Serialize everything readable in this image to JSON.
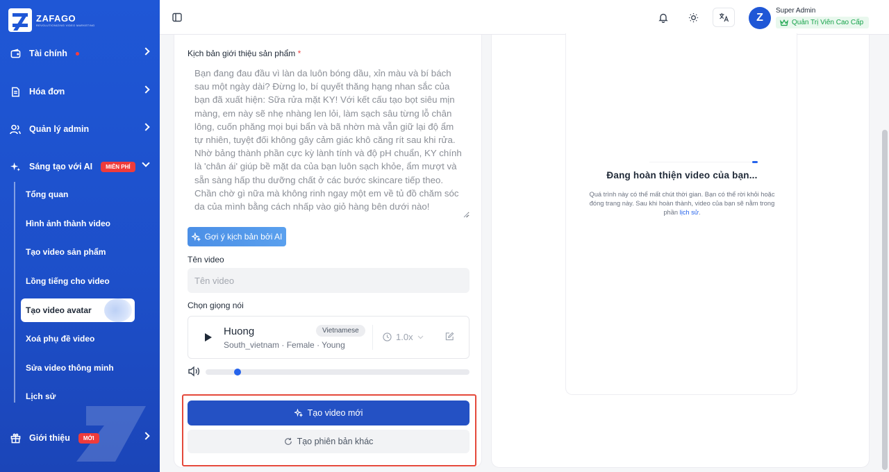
{
  "brand": {
    "name": "ZAFAGO",
    "tagline": "REVOLUTIONIZING VIDEO MARKETING"
  },
  "sidebar": {
    "items": [
      {
        "label": "Tài chính",
        "icon": "wallet-icon"
      },
      {
        "label": "Hóa đơn",
        "icon": "invoice-icon"
      },
      {
        "label": "Quản lý admin",
        "icon": "users-icon"
      },
      {
        "label": "Sáng tạo với AI",
        "icon": "sparkle-icon",
        "badge": "MIỄN PHÍ"
      },
      {
        "label": "Giới thiệu",
        "icon": "gift-icon",
        "badge": "MỚI"
      }
    ],
    "sub_items": [
      "Tổng quan",
      "Hình ảnh thành video",
      "Tạo video sản phẩm",
      "Lồng tiếng cho video",
      "Tạo video avatar",
      "Xoá phụ đề video",
      "Sửa video thông minh",
      "Lịch sử"
    ]
  },
  "topbar": {
    "user_name": "Super Admin",
    "user_role": "Quản Trị Viên Cao Cấp",
    "avatar_letter": "Z"
  },
  "form": {
    "script_label": "Kịch bản giới thiệu sản phẩm",
    "required_mark": "*",
    "script_text": "Bạn đang đau đầu vì làn da luôn bóng dầu, xỉn màu và bí bách sau một ngày dài? Đừng lo, bí quyết thăng hạng nhan sắc của bạn đã xuất hiện: Sữa rửa mặt KY! Với kết cấu tạo bọt siêu mịn màng, em này sẽ nhẹ nhàng len lỏi, làm sạch sâu từng lỗ chân lông, cuốn phăng mọi bụi bẩn và bã nhờn mà vẫn giữ lại độ ẩm tự nhiên, tuyệt đối không gây cảm giác khô căng rít sau khi rửa. Nhờ bảng thành phần cực kỳ lành tính và độ pH chuẩn, KY chính là 'chân ái' giúp bề mặt da của bạn luôn sạch khỏe, ẩm mượt và sẵn sàng hấp thu dưỡng chất ở các bước skincare tiếp theo. Chần chờ gì nữa mà không rinh ngay một em về tủ đồ chăm sóc da của mình bằng cách nhấp vào giỏ hàng bên dưới nào!",
    "ai_button": "Gợi ý kịch bản bởi AI",
    "video_name_label": "Tên video",
    "video_name_placeholder": "Tên video",
    "voice_label": "Chọn giọng nói",
    "voice": {
      "name": "Huong",
      "meta": "South_vietnam · Female · Young",
      "language": "Vietnamese",
      "speed": "1.0x"
    },
    "audio_progress": 0.11,
    "create_button": "Tạo video mới",
    "alt_button": "Tạo phiên bản khác"
  },
  "preview": {
    "title": "Đang hoàn thiện video của bạn...",
    "desc_part1": "Quá trình này có thể mất chút thời gian. Bạn có thể rời khỏi hoặc đóng trang này. Sau khi hoàn thành, video của bạn sẽ nằm trong phần ",
    "desc_link": "lịch sử",
    "desc_end": "."
  },
  "colors": {
    "sidebar_bg": "#1f57d6",
    "primary": "#2451c4",
    "highlight_border": "#e4483a",
    "accent_badge": "#ef3b3b"
  }
}
